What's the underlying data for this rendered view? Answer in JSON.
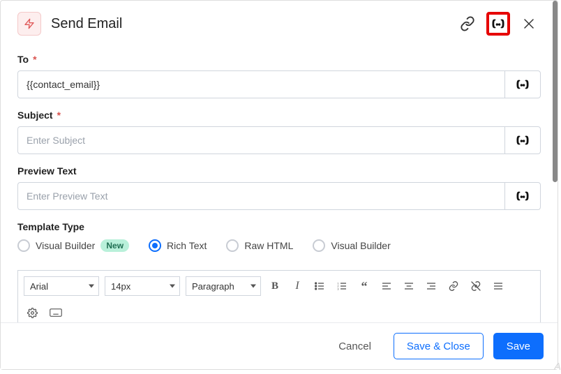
{
  "header": {
    "title": "Send Email"
  },
  "fields": {
    "to": {
      "label": "To",
      "required": true,
      "value": "{{contact_email}}"
    },
    "subject": {
      "label": "Subject",
      "required": true,
      "placeholder": "Enter Subject"
    },
    "preview": {
      "label": "Preview Text",
      "placeholder": "Enter Preview Text"
    },
    "templateType": {
      "label": "Template Type",
      "options": [
        {
          "label": "Visual Builder",
          "badge": "New",
          "selected": false
        },
        {
          "label": "Rich Text",
          "selected": true
        },
        {
          "label": "Raw HTML",
          "selected": false
        },
        {
          "label": "Visual Builder",
          "selected": false
        }
      ]
    }
  },
  "editor": {
    "font": "Arial",
    "size": "14px",
    "block": "Paragraph"
  },
  "footer": {
    "cancel": "Cancel",
    "saveClose": "Save & Close",
    "save": "Save"
  }
}
